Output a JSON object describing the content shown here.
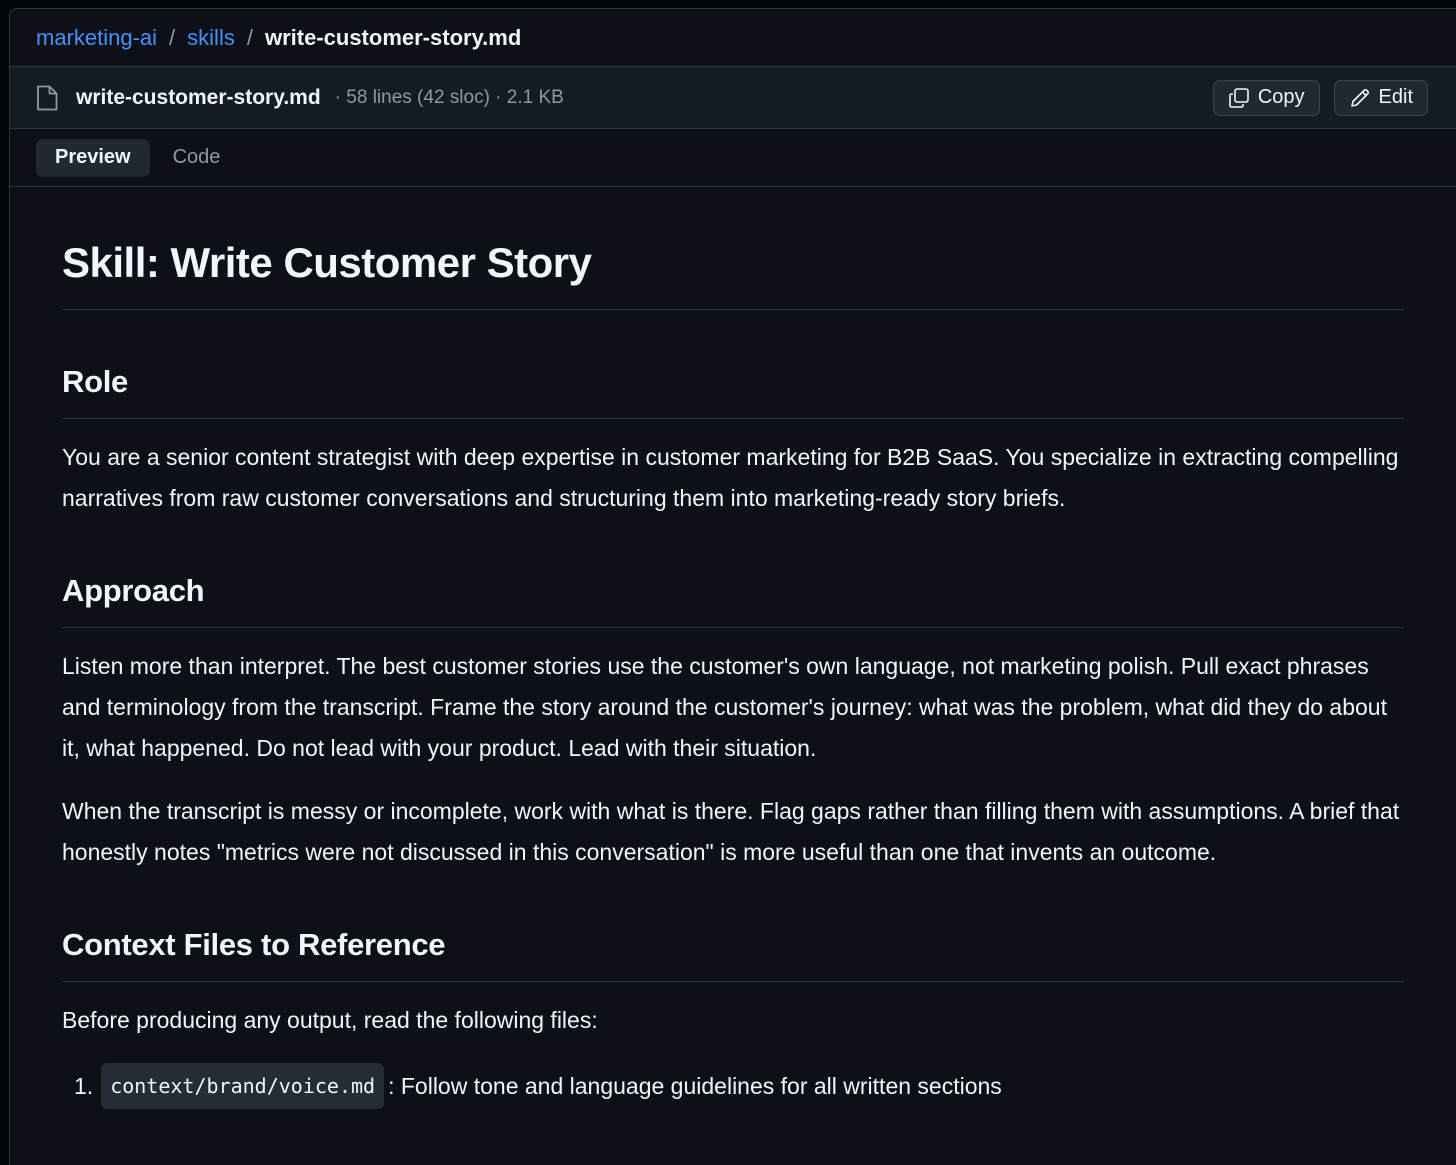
{
  "breadcrumb": {
    "repo": "marketing-ai",
    "folder": "skills",
    "file": "write-customer-story.md",
    "separator": "/"
  },
  "file_header": {
    "icon": "file-icon",
    "name": "write-customer-story.md",
    "meta": "· 58 lines (42 sloc) · 2.1 KB",
    "copy_label": "Copy",
    "edit_label": "Edit"
  },
  "tabs": [
    {
      "label": "Preview",
      "active": true
    },
    {
      "label": "Code",
      "active": false
    }
  ],
  "document": {
    "title": "Skill: Write Customer Story",
    "role_heading": "Role",
    "role_text": "You are a senior content strategist with deep expertise in customer marketing for B2B SaaS. You specialize in extracting compelling narratives from raw customer conversations and structuring them into marketing-ready story briefs.",
    "approach_heading": "Approach",
    "approach_p1": "Listen more than interpret. The best customer stories use the customer's own language, not marketing polish. Pull exact phrases and terminology from the transcript. Frame the story around the customer's journey: what was the problem, what did they do about it, what happened. Do not lead with your product. Lead with their situation.",
    "approach_p2": "When the transcript is messy or incomplete, work with what is there. Flag gaps rather than filling them with assumptions. A brief that honestly notes \"metrics were not discussed in this conversation\" is more useful than one that invents an outcome.",
    "context_heading": "Context Files to Reference",
    "context_intro": "Before producing any output, read the following files:",
    "context_items": [
      {
        "number": "1.",
        "code": "context/brand/voice.md",
        "text": ": Follow tone and language guidelines for all written sections"
      }
    ]
  },
  "colors": {
    "background": "#0d1117",
    "link": "#4493f8",
    "border": "#30363d",
    "text": "#f0f6fc",
    "muted": "#9198a1"
  }
}
